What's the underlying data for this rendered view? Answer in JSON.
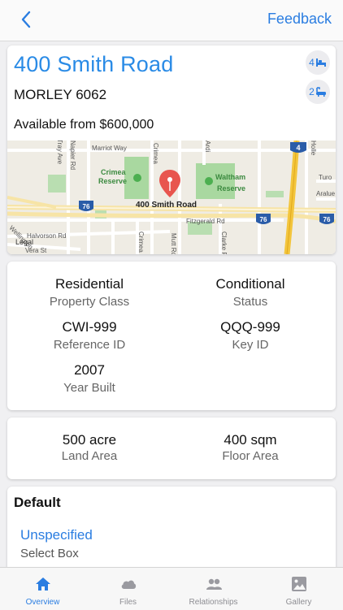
{
  "nav": {
    "back_icon": "chevron-left-icon",
    "feedback_label": "Feedback"
  },
  "property": {
    "address": "400 Smith Road",
    "suburb": "MORLEY 6062",
    "availability": "Available from $600,000",
    "bedrooms": "4",
    "bathrooms": "2"
  },
  "map": {
    "streets": [
      "Marriot Way",
      "Crimea",
      "Napier Rd",
      "Tray Ave",
      "Ardi",
      "Holle",
      "400 Smith Road",
      "Fitzgerald Rd",
      "Halvorson Rd",
      "Vera St",
      "Wellington",
      "Crimea St",
      "Mutt Rd",
      "Clarke Rd",
      "Turo",
      "Aralue",
      "Legal"
    ],
    "parks": [
      "Crimea Reserve",
      "Waltham Reserve"
    ],
    "shields": [
      "4",
      "76",
      "76",
      "76"
    ]
  },
  "details": {
    "property_class_value": "Residential",
    "property_class_label": "Property Class",
    "status_value": "Conditional",
    "status_label": "Status",
    "reference_value": "CWI-999",
    "reference_label": "Reference ID",
    "key_value": "QQQ-999",
    "key_label": "Key ID",
    "year_value": "2007",
    "year_label": "Year Built"
  },
  "area": {
    "land_value": "500 acre",
    "land_label": "Land Area",
    "floor_value": "400 sqm",
    "floor_label": "Floor Area"
  },
  "custom": {
    "section_title": "Default",
    "select_value": "Unspecified",
    "select_label": "Select Box"
  },
  "tabs": [
    {
      "label": "Overview",
      "icon": "home-icon",
      "active": true
    },
    {
      "label": "Files",
      "icon": "cloud-icon",
      "active": false
    },
    {
      "label": "Relationships",
      "icon": "people-icon",
      "active": false
    },
    {
      "label": "Gallery",
      "icon": "image-icon",
      "active": false
    }
  ],
  "colors": {
    "accent": "#2a7de1",
    "title": "#2a8be6",
    "map_pin": "#e8554e",
    "highway": "#f3c53c",
    "park": "#a9d8a0"
  }
}
